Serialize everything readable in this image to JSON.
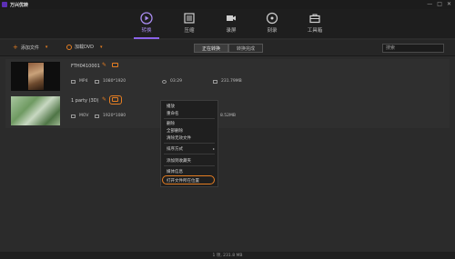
{
  "app": {
    "title": "万兴优转"
  },
  "window_controls": [
    "—",
    "□",
    "✕"
  ],
  "nav": {
    "items": [
      {
        "label": "转换",
        "icon": "convert-icon",
        "active": true
      },
      {
        "label": "压缩",
        "icon": "compress-icon"
      },
      {
        "label": "录屏",
        "icon": "record-icon"
      },
      {
        "label": "刻录",
        "icon": "burn-icon"
      },
      {
        "label": "工具箱",
        "icon": "toolbox-icon"
      }
    ],
    "accent": "#8a63e8"
  },
  "toolbar": {
    "add_file": "添加文件",
    "load_dvd": "加载DVD",
    "tab_converting": "正在转换",
    "tab_converted": "转换完成",
    "search_placeholder": "搜索"
  },
  "files": [
    {
      "name": "FTH0410001",
      "format": "MP4",
      "resolution": "1080*1920",
      "duration": "03:29",
      "size": "231.79MB"
    },
    {
      "name": "1 party (3D)",
      "format": "MOV",
      "resolution": "1920*1080",
      "size": "8.52MB"
    }
  ],
  "context_menu": {
    "items": [
      "播放",
      "重命名",
      "删除",
      "全部删除",
      "清除无效文件",
      "排序方式",
      "添加到收藏夹",
      "媒体信息",
      "打开文件所在位置"
    ]
  },
  "status": {
    "text": "1 项, 231.8 MB"
  },
  "colors": {
    "highlight": "#e67e22",
    "background": "#2b2b2b"
  }
}
